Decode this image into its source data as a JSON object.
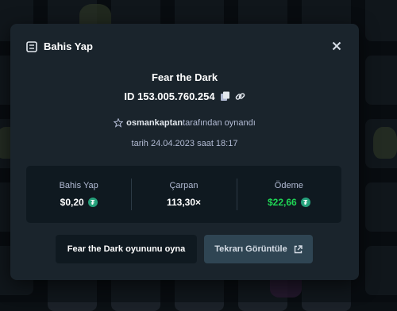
{
  "modal": {
    "title": "Bahis Yap",
    "game_name": "Fear the Dark",
    "bet_id": "ID 153.005.760.254",
    "player_name": "osmankaptan",
    "played_by_suffix": "tarafından oynandı",
    "date_text": "tarih 24.04.2023 saat 18:17"
  },
  "stats": {
    "bet_label": "Bahis Yap",
    "bet_value": "$0,20",
    "multiplier_label": "Çarpan",
    "multiplier_value": "113,30×",
    "payout_label": "Ödeme",
    "payout_value": "$22,66"
  },
  "buttons": {
    "play_label": "Fear the Dark oyununu oyna",
    "replay_label": "Tekrarı Görüntüle"
  },
  "currency_icon": "tether-icon",
  "colors": {
    "modal_bg": "#1a242c",
    "stats_bg": "#0f1920",
    "payout_green": "#1fd655",
    "replay_button_bg": "#2f4553"
  }
}
